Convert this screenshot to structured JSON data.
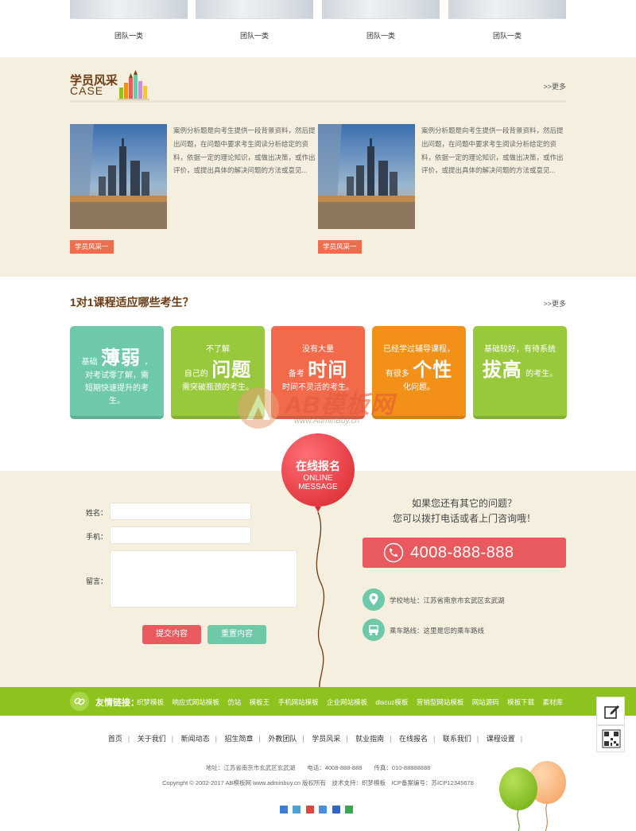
{
  "team": {
    "items": [
      {
        "name": "团队一类"
      },
      {
        "name": "团队一类"
      },
      {
        "name": "团队一类"
      },
      {
        "name": "团队一类"
      }
    ]
  },
  "case_section": {
    "title_cn": "学员风采",
    "title_en": "CASE",
    "more": ">>更多",
    "cards": [
      {
        "text": "案例分析题是向考生提供一段背景资料，然后提出问题，在问题中要求考生阅读分析给定的资料，依据一定的理论知识，或做出决策，或作出评价，或提出具体的解决问题的方法或意见...",
        "tag": "学员风采一"
      },
      {
        "text": "案例分析题是向考生提供一段背景资料，然后提出问题，在问题中要求考生阅读分析给定的资料，依据一定的理论知识，或做出决策，或作出评价，或提出具体的解决问题的方法或意见...",
        "tag": "学员风采一"
      }
    ]
  },
  "course_section": {
    "title": "1对1课程适应哪些考生？",
    "more": ">>更多",
    "boxes": [
      {
        "pre": "基础",
        "big": "薄弱",
        "post": "，",
        "line2": "对考试零了解，需",
        "line3": "短期快速提升的考",
        "line4": "生。",
        "color": "#6dc9a8"
      },
      {
        "pre": "不了解",
        "line1b": "自己的",
        "big": "问题",
        "line2": "需突破瓶颈的考生。",
        "color": "#98c93c"
      },
      {
        "pre": "没有大量",
        "line1b": "备考",
        "big": "时间",
        "line2": "时间不灵活的考生。",
        "color": "#f26a4a"
      },
      {
        "pre": "已经学过辅导课程，",
        "line1b": "有很多",
        "big": "个性",
        "line2": "化问题。",
        "color": "#f39017"
      },
      {
        "pre": "基础较好，有待系统",
        "big": "拔高",
        "post": "的考生。",
        "color": "#98c93c"
      }
    ]
  },
  "watermark": {
    "text": "AB模板网",
    "sub": "www.AdminBuy.cn"
  },
  "signup": {
    "balloon_title": "在线报名",
    "balloon_en1": "ONLINE",
    "balloon_en2": "MESSAGE",
    "labels": {
      "name": "姓名：",
      "phone": "手机：",
      "message": "留言："
    },
    "submit": "提交内容",
    "reset": "重置内容",
    "question1": "如果您还有其它的问题？",
    "question2": "您可以拨打电话或者上门咨询哦！",
    "phone": "4008-888-888",
    "address": "学校地址：江苏省南京市玄武区玄武湖",
    "route": "乘车路线：这里是您的乘车路线"
  },
  "links": {
    "title": "友情链接：",
    "items": [
      "织梦模板",
      "响应式网站模板",
      "仿站",
      "模板王",
      "手机网站模板",
      "企业网站模板",
      "discuz模板",
      "营销型网站模板",
      "网站源码",
      "模板下载",
      "素材库"
    ]
  },
  "footer": {
    "nav": [
      "首页",
      "关于我们",
      "新闻动态",
      "招生简章",
      "外教团队",
      "学员风采",
      "就业指南",
      "在线报名",
      "联系我们",
      "课程设置"
    ],
    "address_line": "地址：江苏省南京市玄武区玄武湖　　电话：4008-888-888　　传真：010-88888888",
    "copyright": "Copyright © 2002-2017 AB模板网 www.adminbuy.cn 版权所有　技术支持：织梦模板　ICP备案编号：苏ICP12345678"
  },
  "colors": {
    "beige": "#f5efe0",
    "brown": "#6b3b12",
    "red": "#e95a5e",
    "mint": "#6dc9a8",
    "green": "#8dc21f"
  }
}
